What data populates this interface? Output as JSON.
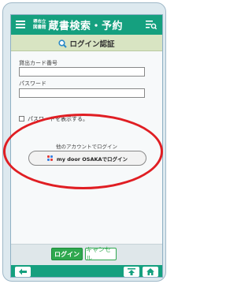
{
  "header": {
    "logo_small_line1": "堺市立",
    "logo_small_line2": "図書館",
    "logo_title": "蔵書検索・予約",
    "menu_icon": "hamburger-menu-icon",
    "settings_icon": "search-settings-icon"
  },
  "page": {
    "title": "ログイン認証",
    "title_icon": "magnifier-icon"
  },
  "form": {
    "card_label": "貸出カード番号",
    "card_value": "",
    "password_label": "パスワード",
    "password_value": "",
    "show_password_label": "パスワードを表示する。"
  },
  "other_login": {
    "heading": "他のアカウントでログイン",
    "mydoor_button": "my door OSAKAでログイン"
  },
  "actions": {
    "login": "ログイン",
    "cancel": "キャンセル"
  },
  "nav": {
    "back_icon": "arrow-left-icon",
    "top_icon": "arrow-up-icon",
    "home_icon": "home-icon"
  },
  "colors": {
    "header": "#15a07f",
    "title_bar": "#d8e4c2",
    "login_button": "#2fa84f",
    "annotation": "#e01e23"
  }
}
